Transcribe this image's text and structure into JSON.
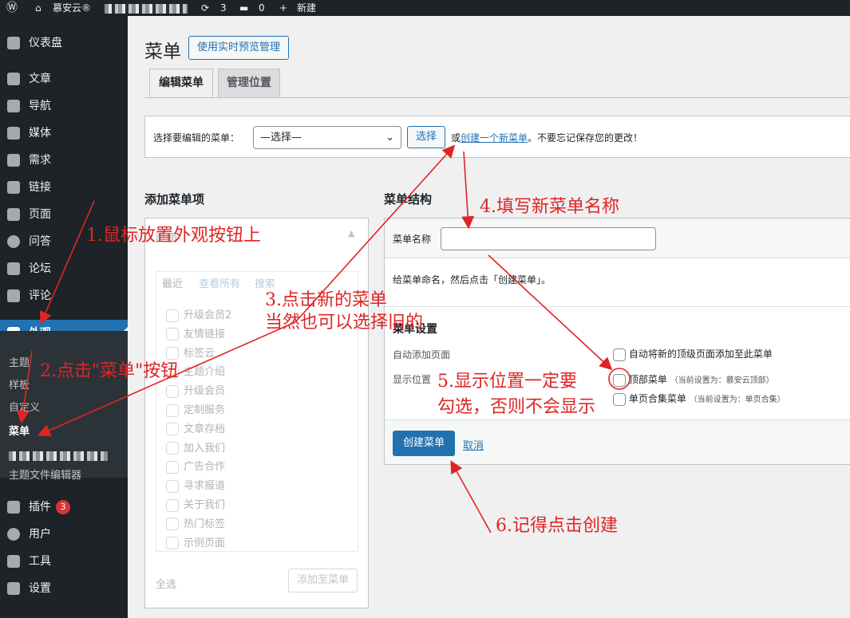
{
  "adminbar": {
    "site_name": "慕安云®",
    "updates_count": "3",
    "comments_count": "0",
    "new_label": "新建"
  },
  "sidebar": {
    "dashboard": "仪表盘",
    "posts": "文章",
    "navigation": "导航",
    "media": "媒体",
    "requirements": "需求",
    "links": "链接",
    "pages": "页面",
    "qa": "问答",
    "forum": "论坛",
    "comments": "评论",
    "appearance": "外观",
    "sub": {
      "themes": "主题",
      "templates": "样板",
      "customize": "自定义",
      "menus": "菜单",
      "theme_editor": "主题文件编辑器"
    },
    "plugins": "插件",
    "plugins_badge": "3",
    "users": "用户",
    "tools": "工具",
    "settings": "设置"
  },
  "page": {
    "title": "菜单",
    "live_preview_button": "使用实时预览管理",
    "tabs": [
      "编辑菜单",
      "管理位置"
    ],
    "select_label": "选择要编辑的菜单：",
    "select_value": "—选择—",
    "select_button": "选择",
    "or_text": "或",
    "create_new_link": "创建一个新菜单",
    "reminder": "。不要忘记保存您的更改！"
  },
  "add_items": {
    "heading": "添加菜单项",
    "pages_title": "页面",
    "tabs": [
      "最近",
      "查看所有",
      "搜索"
    ],
    "pages": [
      "升级会员2",
      "友情链接",
      "标签云",
      "主题介绍",
      "升级会员",
      "定制服务",
      "文章存档",
      "加入我们",
      "广告合作",
      "寻求报道",
      "关于我们",
      "热门标签",
      "示例页面"
    ],
    "select_all": "全选",
    "add_button": "添加至菜单"
  },
  "structure": {
    "heading": "菜单结构",
    "name_label": "菜单名称",
    "name_value": "",
    "hint": "给菜单命名，然后点击「创建菜单」。",
    "settings_title": "菜单设置",
    "auto_add_label": "自动添加页面",
    "auto_add_option": "自动将新的顶级页面添加至此菜单",
    "location_label": "显示位置",
    "locations": [
      {
        "name": "顶部菜单",
        "note": "（当前设置为：慕安云顶部）"
      },
      {
        "name": "单页合集菜单",
        "note": "（当前设置为：单页合集）"
      }
    ],
    "create_button": "创建菜单",
    "cancel_link": "取消"
  },
  "annotations": {
    "step1": "1.鼠标放置外观按钮上",
    "step2": "2.点击\"菜单\"按钮",
    "step3_line1": "3.点击新的菜单",
    "step3_line2": "当然也可以选择旧的",
    "step4": "4.填写新菜单名称",
    "step5_line1": "5.显示位置一定要",
    "step5_line2": "勾选，否则不会显示",
    "step6": "6.记得点击创建",
    "color": "#e02424"
  }
}
